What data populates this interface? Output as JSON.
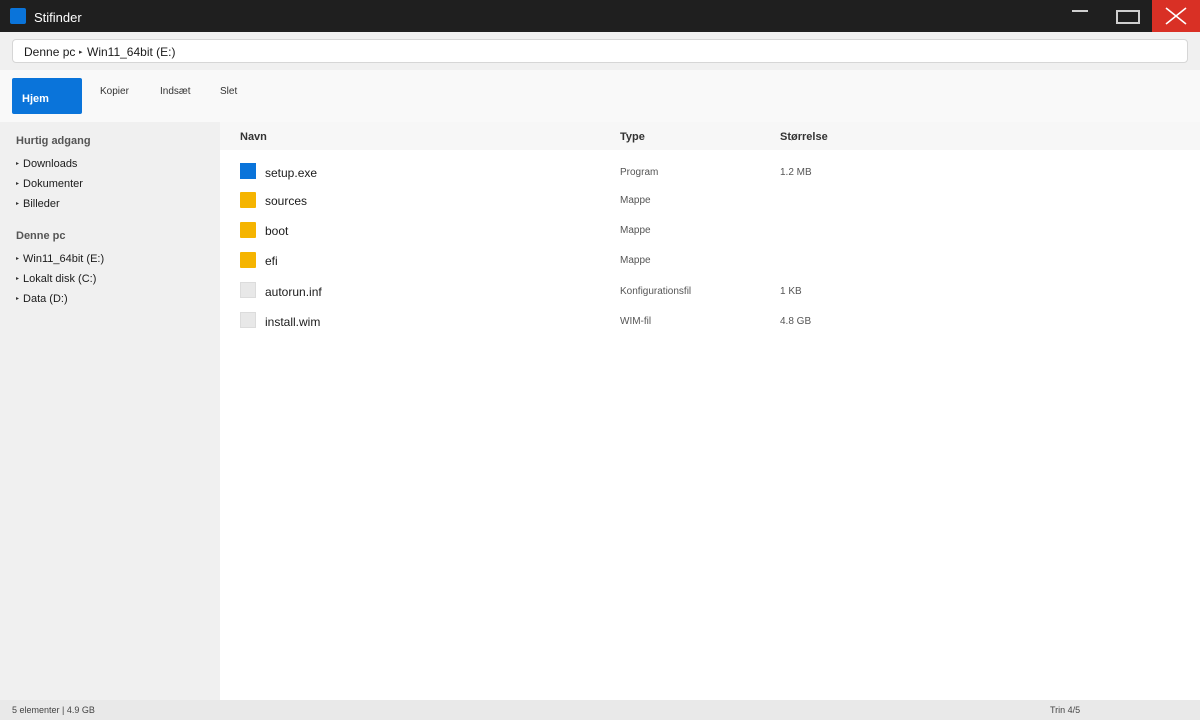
{
  "window": {
    "title": "Stifinder",
    "icon": "app-icon",
    "controls": [
      "minimize-icon",
      "maximize-icon",
      "close-icon"
    ]
  },
  "address": {
    "crumbs": [
      "Denne pc",
      "Win11_64bit (E:)"
    ],
    "separator_icon": "chevron-right-icon"
  },
  "ribbon": {
    "home": "Hjem",
    "copy": "Kopier",
    "paste": "Indsæt",
    "delete": "Slet"
  },
  "sidebar": {
    "quick_access": {
      "heading": "Hurtig adgang",
      "items": [
        "Downloads",
        "Dokumenter",
        "Billeder"
      ]
    },
    "this_pc": {
      "heading": "Denne pc",
      "items": [
        "Win11_64bit (E:)",
        "Lokalt disk (C:)",
        "Data (D:)"
      ]
    }
  },
  "file_list": {
    "columns": [
      "Navn",
      "Type",
      "Størrelse"
    ],
    "files": [
      {
        "name": "setup.exe",
        "type": "Program",
        "size": "1.2 MB",
        "icon": "executable-icon"
      },
      {
        "name": "sources",
        "type": "Mappe",
        "size": "",
        "icon": "folder-icon"
      },
      {
        "name": "boot",
        "type": "Mappe",
        "size": "",
        "icon": "folder-icon"
      },
      {
        "name": "efi",
        "type": "Mappe",
        "size": "",
        "icon": "folder-icon"
      },
      {
        "name": "autorun.inf",
        "type": "Konfigurationsfil",
        "size": "1 KB",
        "icon": "file-icon"
      },
      {
        "name": "install.wim",
        "type": "WIM-fil",
        "size": "4.8 GB",
        "icon": "file-icon"
      }
    ]
  },
  "status": {
    "left": "5 elementer | 4.9 GB",
    "right": "Trin 4/5"
  },
  "colors": {
    "accent": "#0a74da",
    "close": "#d93025",
    "folder": "#f5b400",
    "titlebar": "#1f1f1f"
  }
}
